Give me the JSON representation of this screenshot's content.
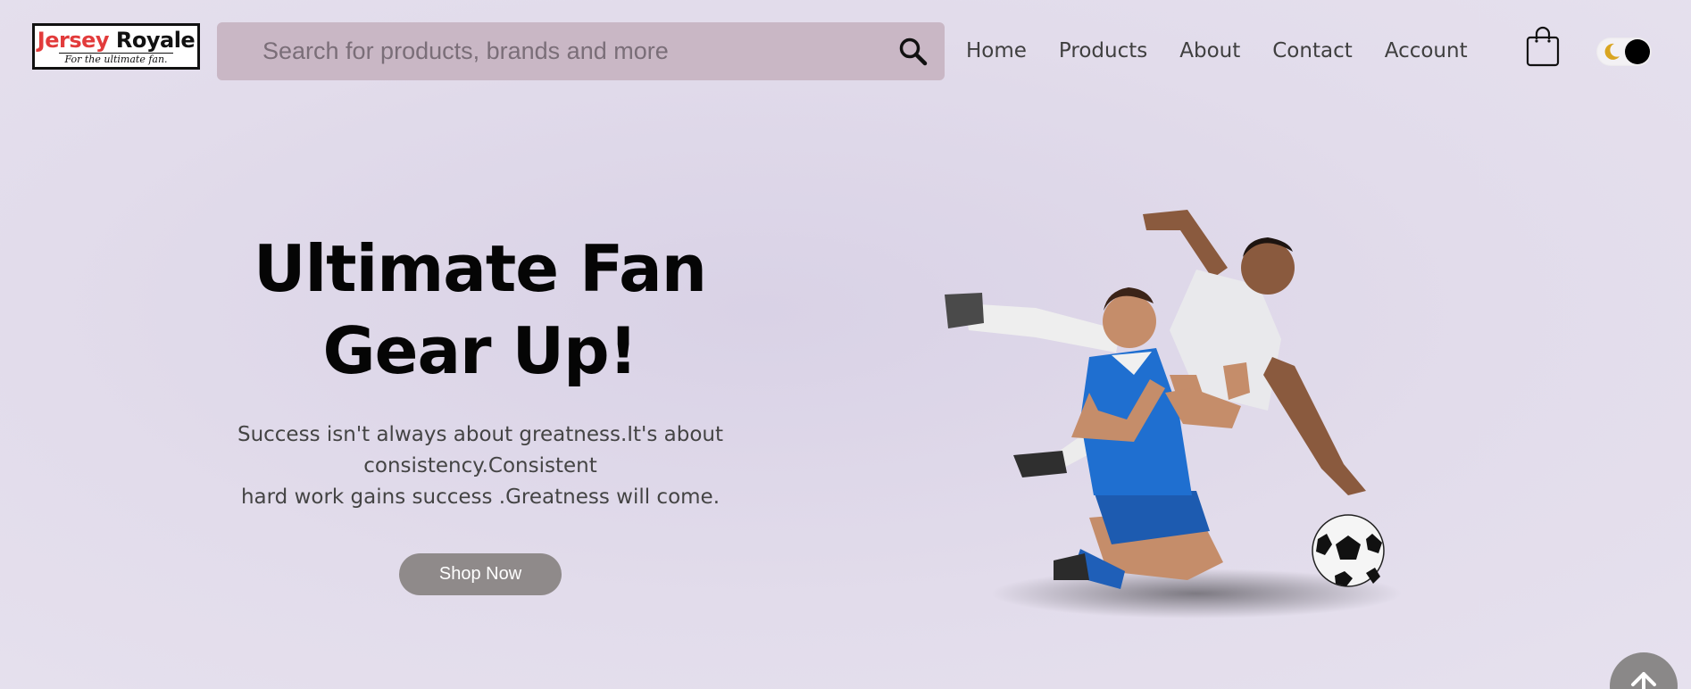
{
  "header": {
    "logo": {
      "part1": "Jersey",
      "part2": "Royale",
      "tagline": "For the ultimate fan."
    },
    "search": {
      "placeholder": "Search for products, brands and more",
      "value": ""
    },
    "nav": [
      "Home",
      "Products",
      "About",
      "Contact",
      "Account"
    ],
    "icons": {
      "search": "search-icon",
      "cart": "shopping-bag-icon",
      "theme": "moon-icon"
    }
  },
  "hero": {
    "title_line1": "Ultimate Fan",
    "title_line2": "Gear Up!",
    "subtitle_line1": "Success isn't always about greatness.It's about",
    "subtitle_line2": "consistency.Consistent",
    "subtitle_line3": "hard work gains success .Greatness will come.",
    "cta": "Shop Now"
  },
  "colors": {
    "search_bg": "#c9b7c5",
    "button_bg": "#8f8a8a",
    "logo_red": "#e23b3b",
    "jersey_blue": "#1f6fd0",
    "moon": "#d9a520"
  },
  "scroll_top_icon": "arrow-up-icon"
}
